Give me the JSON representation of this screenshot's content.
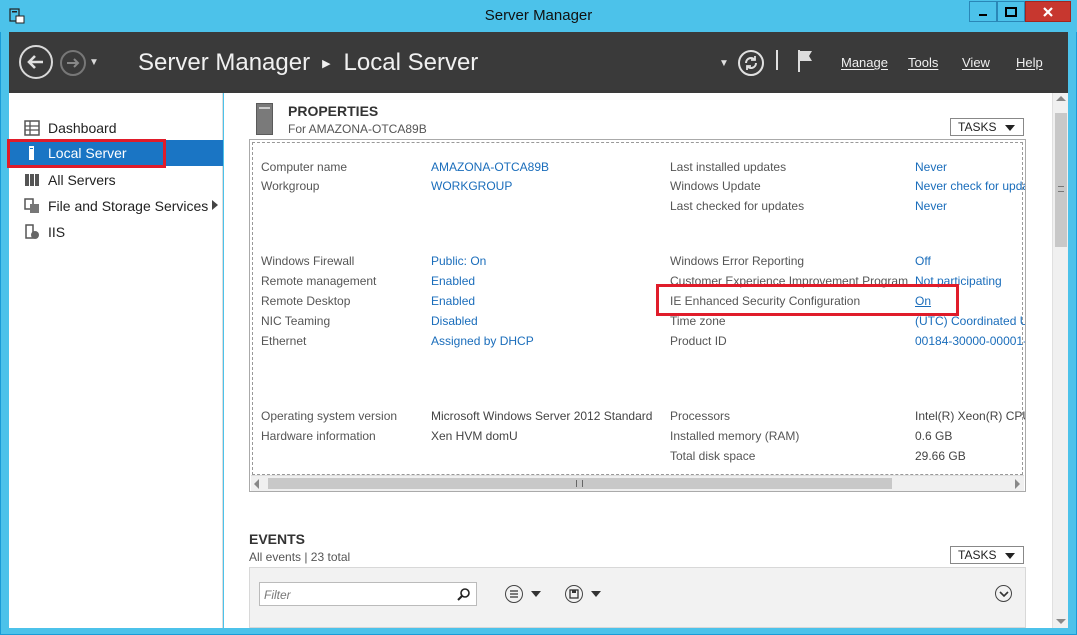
{
  "window": {
    "title": "Server Manager"
  },
  "header": {
    "breadcrumb": [
      "Server Manager",
      "Local Server"
    ],
    "menu": {
      "manage": "Manage",
      "tools": "Tools",
      "view": "View",
      "help": "Help"
    }
  },
  "sidebar": {
    "items": [
      {
        "label": "Dashboard",
        "icon": "dashboard-icon"
      },
      {
        "label": "Local Server",
        "icon": "server-icon",
        "active": true
      },
      {
        "label": "All Servers",
        "icon": "servers-icon"
      },
      {
        "label": "File and Storage Services",
        "icon": "storage-icon"
      },
      {
        "label": "IIS",
        "icon": "iis-icon"
      }
    ]
  },
  "properties": {
    "title": "PROPERTIES",
    "subtitle": "For AMAZONA-OTCA89B",
    "tasks_label": "TASKS",
    "left": [
      {
        "label": "Computer name",
        "value": "AMAZONA-OTCA89B"
      },
      {
        "label": "Workgroup",
        "value": "WORKGROUP"
      },
      {
        "label": "Windows Firewall",
        "value": "Public: On"
      },
      {
        "label": "Remote management",
        "value": "Enabled"
      },
      {
        "label": "Remote Desktop",
        "value": "Enabled"
      },
      {
        "label": "NIC Teaming",
        "value": "Disabled"
      },
      {
        "label": "Ethernet",
        "value": "Assigned by DHCP"
      },
      {
        "label": "Operating system version",
        "value": "Microsoft Windows Server 2012 Standard"
      },
      {
        "label": "Hardware information",
        "value": "Xen HVM domU"
      }
    ],
    "right": [
      {
        "label": "Last installed updates",
        "value": "Never"
      },
      {
        "label": "Windows Update",
        "value": "Never check for upda"
      },
      {
        "label": "Last checked for updates",
        "value": "Never"
      },
      {
        "label": "Windows Error Reporting",
        "value": "Off"
      },
      {
        "label": "Customer Experience Improvement Program",
        "value": "Not participating"
      },
      {
        "label": "IE Enhanced Security Configuration",
        "value": "On"
      },
      {
        "label": "Time zone",
        "value": "(UTC) Coordinated U"
      },
      {
        "label": "Product ID",
        "value": "00184-30000-00001-"
      },
      {
        "label": "Processors",
        "value": "Intel(R) Xeon(R) CPU"
      },
      {
        "label": "Installed memory (RAM)",
        "value": "0.6 GB"
      },
      {
        "label": "Total disk space",
        "value": "29.66 GB"
      }
    ]
  },
  "events": {
    "title": "EVENTS",
    "subtitle": "All events | 23 total",
    "tasks_label": "TASKS",
    "filter_placeholder": "Filter"
  }
}
